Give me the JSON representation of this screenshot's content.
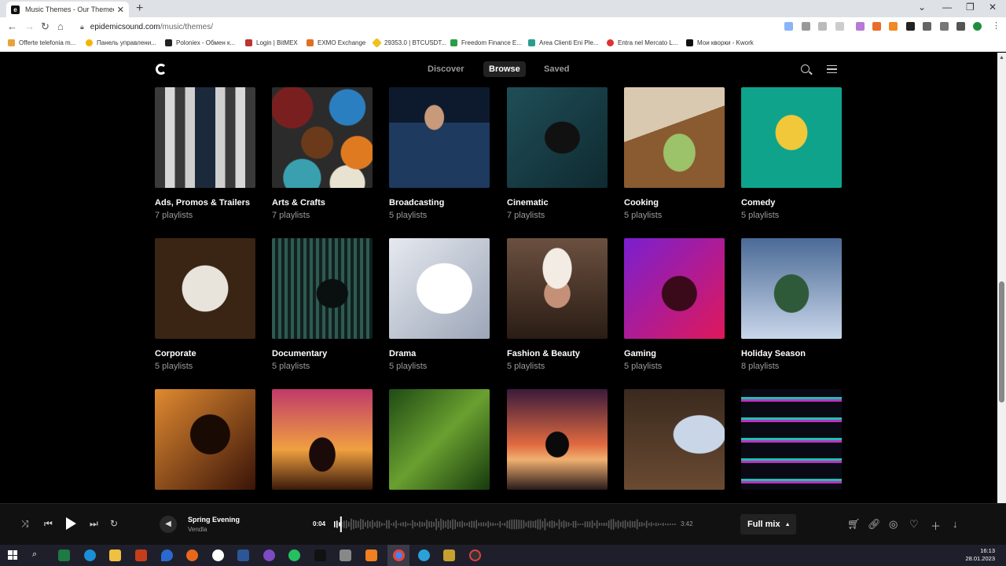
{
  "browser": {
    "tab_title": "Music Themes - Our Themed Pl...",
    "url_host": "epidemicsound.com",
    "url_path": "/music/themes/",
    "bookmarks": [
      "Offerte telefonia m...",
      "Панель управлени...",
      "Poloniex - Обмен к...",
      "Login | BitMEX",
      "EXMO Exchange",
      "29353.0 | BTCUSDT...",
      "Freedom Finance E...",
      "Area Clienti Eni Ple...",
      "Entra nel Mercato L...",
      "Мои кворки - Kwork"
    ]
  },
  "nav": {
    "discover": "Discover",
    "browse": "Browse",
    "saved": "Saved"
  },
  "themes": [
    {
      "name": "Ads, Promos & Trailers",
      "count": "7 playlists"
    },
    {
      "name": "Arts & Crafts",
      "count": "7 playlists"
    },
    {
      "name": "Broadcasting",
      "count": "5 playlists"
    },
    {
      "name": "Cinematic",
      "count": "7 playlists"
    },
    {
      "name": "Cooking",
      "count": "5 playlists"
    },
    {
      "name": "Comedy",
      "count": "5 playlists"
    },
    {
      "name": "Corporate",
      "count": "5 playlists"
    },
    {
      "name": "Documentary",
      "count": "5 playlists"
    },
    {
      "name": "Drama",
      "count": "5 playlists"
    },
    {
      "name": "Fashion & Beauty",
      "count": "5 playlists"
    },
    {
      "name": "Gaming",
      "count": "5 playlists"
    },
    {
      "name": "Holiday Season",
      "count": "8 playlists"
    }
  ],
  "player": {
    "track_title": "Spring Evening",
    "artist": "Vendla",
    "elapsed": "0:04",
    "duration": "3:42",
    "progress": 0.018,
    "mix": "Full mix"
  },
  "taskbar": {
    "time": "16:13",
    "date": "28.01.2023"
  },
  "colors": {
    "background": "#000000",
    "player_bg": "#111111"
  }
}
